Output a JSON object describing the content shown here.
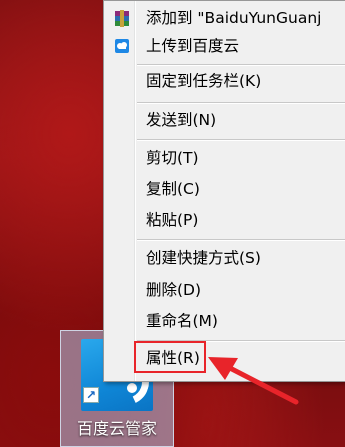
{
  "menu": {
    "items": [
      {
        "label": "添加到 \"BaiduYunGuanj",
        "icon": "winrar-books-icon"
      },
      {
        "label": "上传到百度云",
        "icon": "baidu-cloud-upload-icon"
      },
      {
        "label": "固定到任务栏(K)"
      },
      {
        "label": "发送到(N)"
      },
      {
        "label": "剪切(T)"
      },
      {
        "label": "复制(C)"
      },
      {
        "label": "粘贴(P)"
      },
      {
        "label": "创建快捷方式(S)"
      },
      {
        "label": "删除(D)"
      },
      {
        "label": "重命名(M)"
      },
      {
        "label": "属性(R)"
      }
    ]
  },
  "desktop": {
    "shortcut_label": "百度云管家",
    "shortcut_icon": "baidu-yun-guanjia-icon"
  },
  "colors": {
    "highlight": "#e8242a",
    "menu_bg": "#f0f0f0",
    "wallpaper": "#8a1214"
  }
}
